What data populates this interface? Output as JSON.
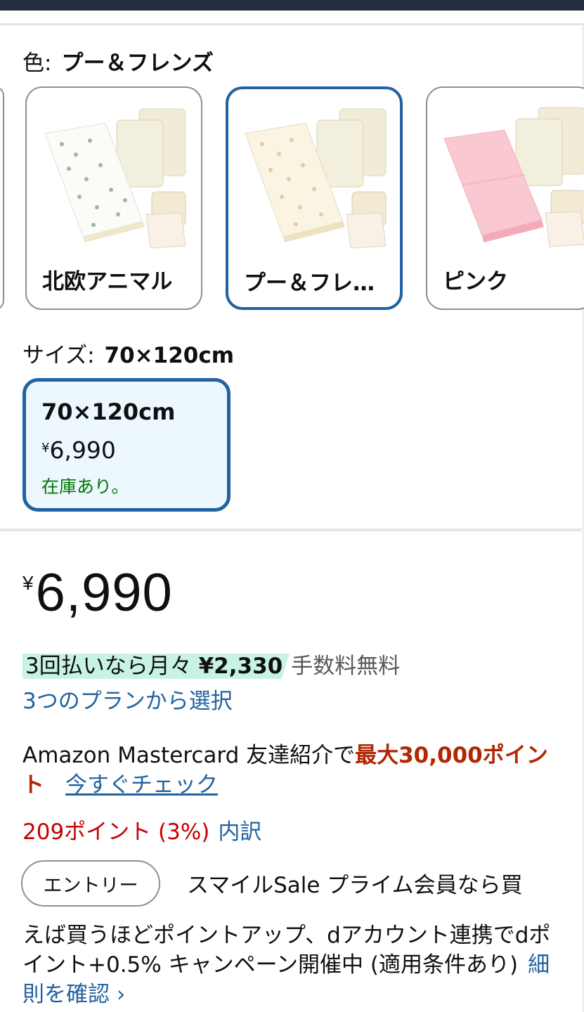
{
  "color_selector": {
    "label": "色:",
    "selected_value": "プー＆フレンズ",
    "options": [
      {
        "name": "北欧アニマル",
        "mat_color": "#fbfbf7",
        "pattern_color": "#9fb7a2"
      },
      {
        "name": "プー＆フレ…",
        "mat_color": "#fbf4e3",
        "pattern_color": "#e3cda0"
      },
      {
        "name": "ピンク",
        "mat_color": "#f9c8d0",
        "pattern_color": "#f9c8d0"
      }
    ]
  },
  "size_selector": {
    "label": "サイズ:",
    "selected_value": "70×120cm",
    "option": {
      "size": "70×120cm",
      "currency": "¥",
      "price": "6,990",
      "availability": "在庫あり。"
    }
  },
  "price": {
    "currency": "¥",
    "amount": "6,990"
  },
  "installment": {
    "text": "3回払いなら月々",
    "amount": "¥2,330",
    "fee": "手数料無料",
    "plan_link": "3つのプランから選択"
  },
  "card_promo": {
    "text": "Amazon Mastercard 友達紹介で",
    "highlight": "最大30,000ポイント",
    "link": "今すぐチェック"
  },
  "points": {
    "text": "209ポイント (3%)",
    "link": "内訳"
  },
  "sale": {
    "entry_button": "エントリー",
    "line1": "スマイルSale プライム会員なら買",
    "line2": "えば買うほどポイントアップ、dアカウント連携でdポイント+0.5% キャンペーン開催中 (適用条件あり)",
    "link": "細則を確認 ›"
  },
  "colors": {
    "link": "#2162a1",
    "selected_border": "#2162a1",
    "price_red": "#c40000",
    "promo_red": "#b12704",
    "in_stock": "#007600",
    "installment_highlight": "#c8f3e2"
  }
}
